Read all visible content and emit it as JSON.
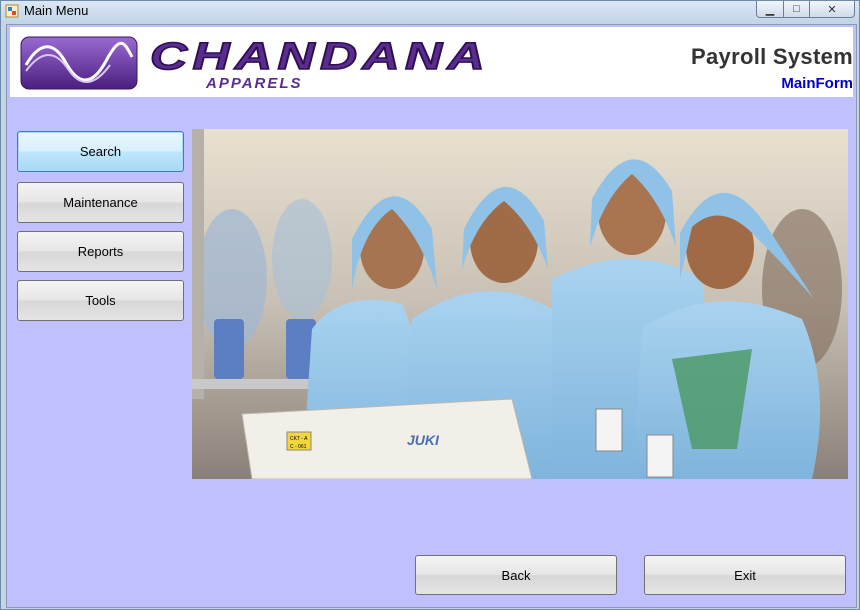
{
  "window": {
    "title": "Main Menu",
    "controls": {
      "minimize": "▁",
      "maximize": "□",
      "close": "✕"
    }
  },
  "header": {
    "logo_text": "CHANDANA",
    "logo_subtext": "APPARELS",
    "system_title": "Payroll System",
    "form_name": "MainForm"
  },
  "menu": {
    "items": [
      {
        "label": "Search"
      },
      {
        "label": "Maintenance"
      },
      {
        "label": "Reports"
      },
      {
        "label": "Tools"
      }
    ]
  },
  "photo": {
    "machine_brand": "JUKI",
    "machine_tag_line1": "CKT - A",
    "machine_tag_line2": "C - 061"
  },
  "footer": {
    "back_label": "Back",
    "exit_label": "Exit"
  },
  "colors": {
    "client_bg": "#c0c0ff",
    "logo_purple": "#5a2d8c",
    "form_name": "#0000cc"
  }
}
